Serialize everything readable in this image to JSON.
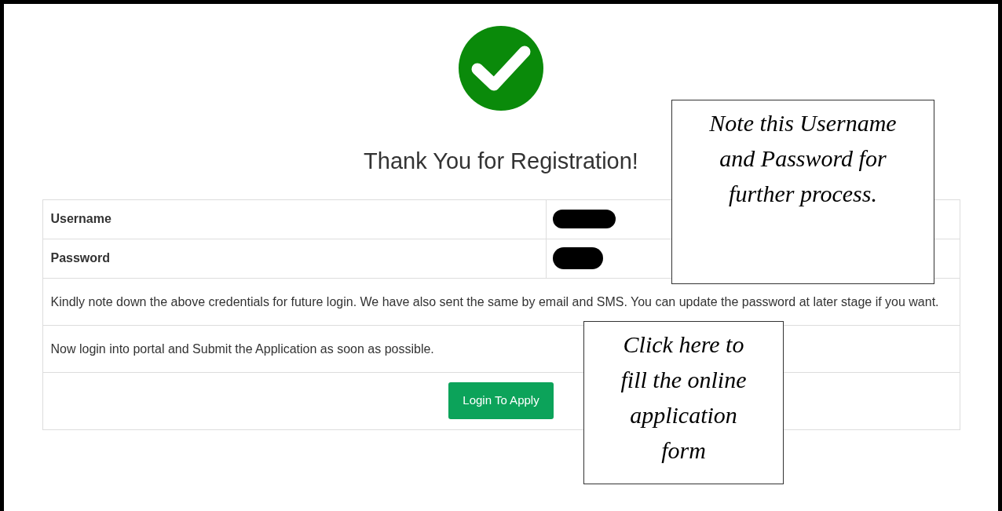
{
  "title": "Thank You for Registration!",
  "credentials": [
    {
      "label": "Username"
    },
    {
      "label": "Password"
    }
  ],
  "notes": [
    "Kindly note down the above credentials for future login. We have also sent the same by email and SMS. You can update the password at later stage if you want.",
    "Now login into portal and Submit the Application as soon as possible."
  ],
  "button": {
    "label": "Login To Apply"
  },
  "callouts": [
    {
      "text": "Note this Username and Password for further process."
    },
    {
      "text": "Click here to fill the online application form"
    }
  ]
}
